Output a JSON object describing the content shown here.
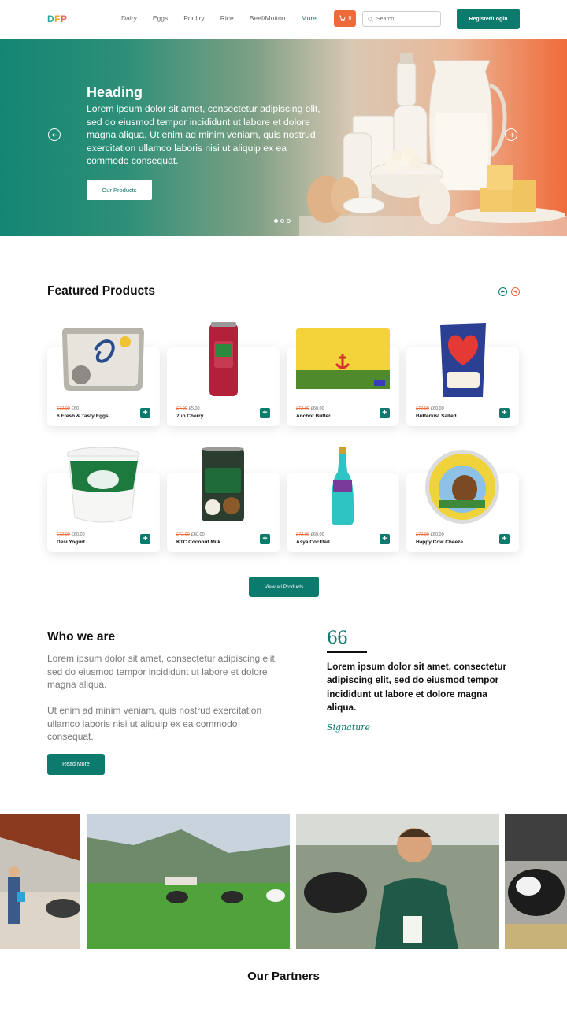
{
  "header": {
    "logo": [
      "D",
      "F",
      "P"
    ],
    "nav": [
      "Dairy",
      "Eggs",
      "Poultry",
      "Rice",
      "Beef/Mutton",
      "More"
    ],
    "cart_count": "0",
    "search_placeholder": "Search",
    "register_label": "Register/Login"
  },
  "hero": {
    "heading": "Heading",
    "text": "Lorem ipsum dolor sit amet, consectetur adipiscing elit, sed do eiusmod tempor incididunt ut labore et dolore magna aliqua. Ut enim ad minim veniam, quis nostrud exercitation ullamco laboris nisi ut aliquip ex ea commodo consequat.",
    "button": "Our Products",
    "slide_count": 3,
    "active_slide": 1
  },
  "featured": {
    "title": "Featured Products",
    "products": [
      {
        "name": "6 Fresh & Tasty Eggs",
        "old_price": "£72.00",
        "price": "£60"
      },
      {
        "name": "7up Cherry",
        "old_price": "£7.00",
        "price": "£5.00"
      },
      {
        "name": "Anchor Butter",
        "old_price": "£72.00",
        "price": "£60.00"
      },
      {
        "name": "Butterkist Salted",
        "old_price": "£72.00",
        "price": "£60.00"
      },
      {
        "name": "Desi Yogurt",
        "old_price": "£72.00",
        "price": "£60.00"
      },
      {
        "name": "KTC Coconut Milk",
        "old_price": "£72.00",
        "price": "£60.00"
      },
      {
        "name": "Asya Cocktail",
        "old_price": "£72.00",
        "price": "£60.00"
      },
      {
        "name": "Happy Cow Cheeze",
        "old_price": "£72.00",
        "price": "£60.00"
      }
    ],
    "view_all": "View all Products"
  },
  "who": {
    "title": "Who we are",
    "para1": "Lorem ipsum dolor sit amet, consectetur adipiscing elit, sed do eiusmod tempor incididunt ut labore et dolore magna aliqua.",
    "para2": "Ut enim ad minim veniam, quis nostrud exercitation ullamco laboris nisi ut aliquip ex ea commodo consequat.",
    "button": "Read More",
    "quote_mark": "66",
    "quote": "Lorem ipsum dolor sit amet, consectetur adipiscing elit, sed do eiusmod tempor incididunt ut labore et dolore magna aliqua.",
    "signature": "Signature"
  },
  "partners": {
    "title": "Our Partners"
  },
  "colors": {
    "primary": "#0d7a6e",
    "accent": "#ee6a3b"
  }
}
